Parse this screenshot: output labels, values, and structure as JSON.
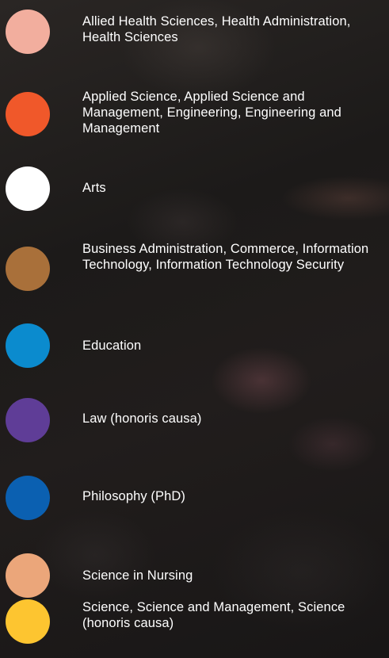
{
  "legend": {
    "items": [
      {
        "label": "Allied Health Sciences, Health Administration, Health Sciences",
        "color": "#F2AE9E"
      },
      {
        "label": "Applied Science, Applied Science and Management, Engineering, Engineering and Management",
        "color": "#F0582A"
      },
      {
        "label": "Arts",
        "color": "#FFFFFF"
      },
      {
        "label": "Business Administration, Commerce, Information Technology, Information Technology Security",
        "color": "#A9703A"
      },
      {
        "label": "Education",
        "color": "#0B8BCE"
      },
      {
        "label": "Law (honoris causa)",
        "color": "#5F3D97"
      },
      {
        "label": "Philosophy (PhD)",
        "color": "#0B60B1"
      },
      {
        "label": "Science in Nursing",
        "color": "#EBA67A"
      },
      {
        "label": "Science, Science and Management, Science (honoris causa)",
        "color": "#FDC530"
      }
    ]
  }
}
